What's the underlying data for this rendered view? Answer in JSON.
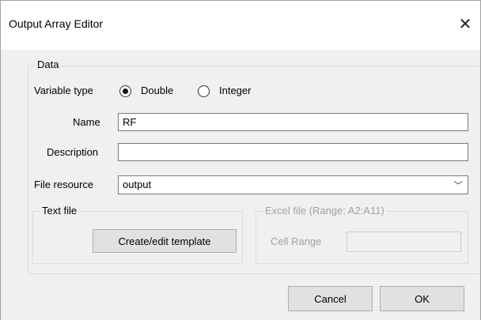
{
  "window": {
    "title": "Output Array Editor"
  },
  "data_group": {
    "legend": "Data",
    "variable_type": {
      "label": "Variable type",
      "options": [
        {
          "label": "Double",
          "checked": true
        },
        {
          "label": "Integer",
          "checked": false
        }
      ]
    },
    "name": {
      "label": "Name",
      "value": "RF"
    },
    "description": {
      "label": "Description",
      "value": ""
    },
    "file_resource": {
      "label": "File resource",
      "value": "output"
    },
    "text_file": {
      "legend": "Text file",
      "button_label": "Create/edit template"
    },
    "excel_file": {
      "legend": "Excel file (Range: A2:A11)",
      "cell_range_label": "Cell Range",
      "cell_range_value": ""
    }
  },
  "buttons": {
    "cancel": "Cancel",
    "ok": "OK"
  }
}
